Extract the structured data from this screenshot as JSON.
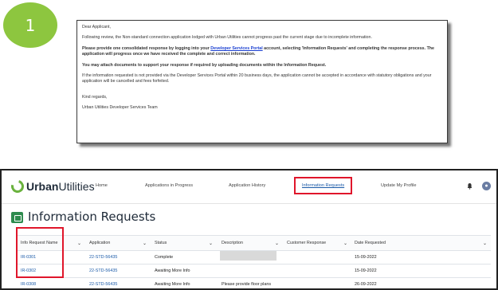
{
  "step_badge": "1",
  "email": {
    "greeting": "Dear Applicant,",
    "para1": "Following review, the Non-standard connection application lodged with Urban Utilities cannot progress past the current stage due to incomplete information.",
    "para2_before": "Please provide one consolidated response by logging into your ",
    "para2_link": "Developer Services Portal",
    "para2_after": " account, selecting 'Information Requests' and completing the response process. The application will progress once we have received the complete and correct information.",
    "para3": "You may attach documents to support your response if required by uploading documents within the Information Request.",
    "para4": "If the information requested is not provided via the Developer Services Portal within 20 business days, the application cannot be accepted in accordance with statutory obligations and your application will be cancelled and fees forfeited.",
    "signoff": "Kind regards,",
    "signature": "Urban Utilities Developer Services Team"
  },
  "app": {
    "logo_part1": "Urban",
    "logo_part2": "Utilities",
    "nav": [
      "Home",
      "Applications in Progress",
      "Application History",
      "Information Requests",
      "Update My Profile"
    ],
    "page_title": "Information Requests",
    "columns": [
      "Info Request Name",
      "Application",
      "Status",
      "Description",
      "Customer Response",
      "Date Requested"
    ],
    "rows": [
      {
        "name": "IR-0301",
        "application": "22-STD-56435",
        "status": "Complete",
        "description": "",
        "response": "",
        "date": "15-09-2022"
      },
      {
        "name": "IR-0302",
        "application": "22-STD-56435",
        "status": "Awaiting More Info",
        "description": "",
        "response": "",
        "date": "15-09-2022"
      },
      {
        "name": "IR-0308",
        "application": "22-STD-56435",
        "status": "Awaiting More Info",
        "description": "Please provide floor plans",
        "response": "",
        "date": "26-09-2022"
      }
    ]
  },
  "colors": {
    "badge": "#8dc63f",
    "highlight": "#e0162b",
    "link": "#1a5aa8",
    "brand_green": "#6ab23e"
  }
}
